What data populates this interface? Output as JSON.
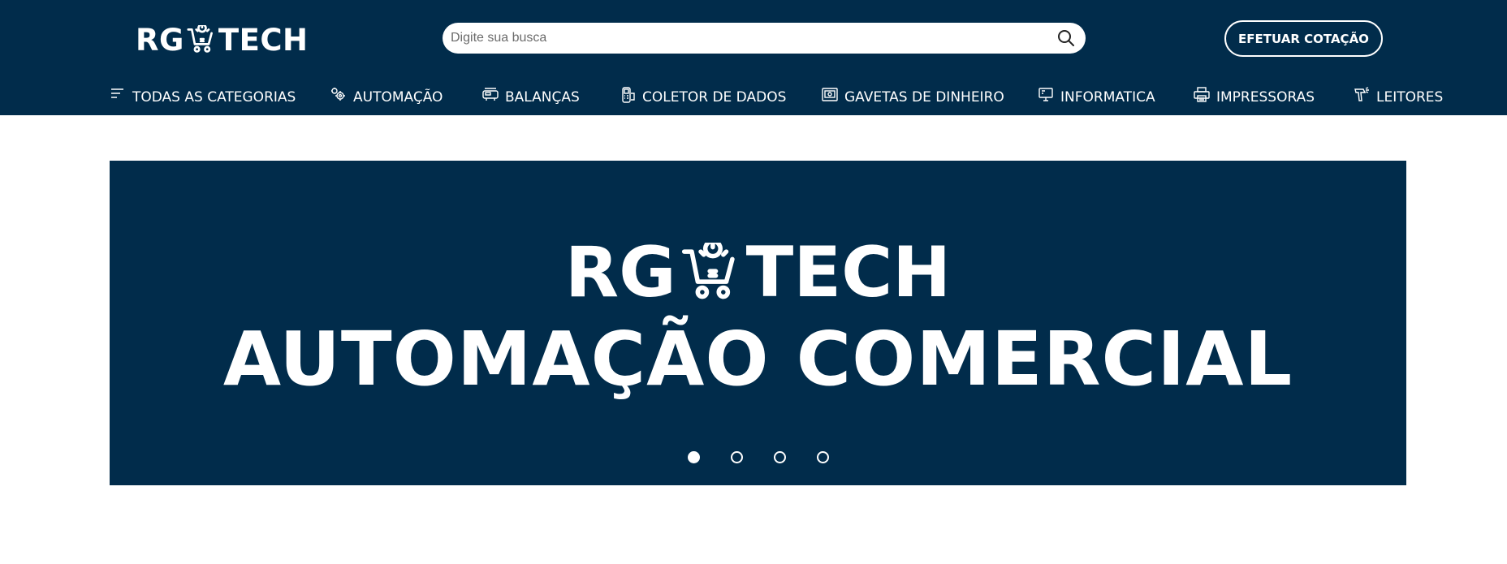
{
  "header": {
    "logo_left": "RG",
    "logo_right": "TECH",
    "search_placeholder": "Digite sua busca",
    "quote_button": "EFETUAR COTAÇÃO"
  },
  "nav": {
    "items": [
      {
        "label": "TODAS AS CATEGORIAS",
        "icon": "menu-lines-icon"
      },
      {
        "label": "AUTOMAÇÃO",
        "icon": "gears-icon"
      },
      {
        "label": "BALANÇAS",
        "icon": "scale-icon"
      },
      {
        "label": "COLETOR DE DADOS",
        "icon": "data-collector-icon"
      },
      {
        "label": "GAVETAS DE DINHEIRO",
        "icon": "cash-drawer-icon"
      },
      {
        "label": "INFORMATICA",
        "icon": "computer-icon"
      },
      {
        "label": "IMPRESSORAS",
        "icon": "printer-icon"
      },
      {
        "label": "LEITORES",
        "icon": "barcode-scanner-icon"
      }
    ]
  },
  "banner": {
    "logo_left": "RG",
    "logo_right": "TECH",
    "title": "AUTOMAÇÃO COMERCIAL",
    "slides": 4,
    "active_slide": 1
  },
  "colors": {
    "primary": "#012c4b",
    "text_on_primary": "#ffffff",
    "background": "#ffffff"
  }
}
